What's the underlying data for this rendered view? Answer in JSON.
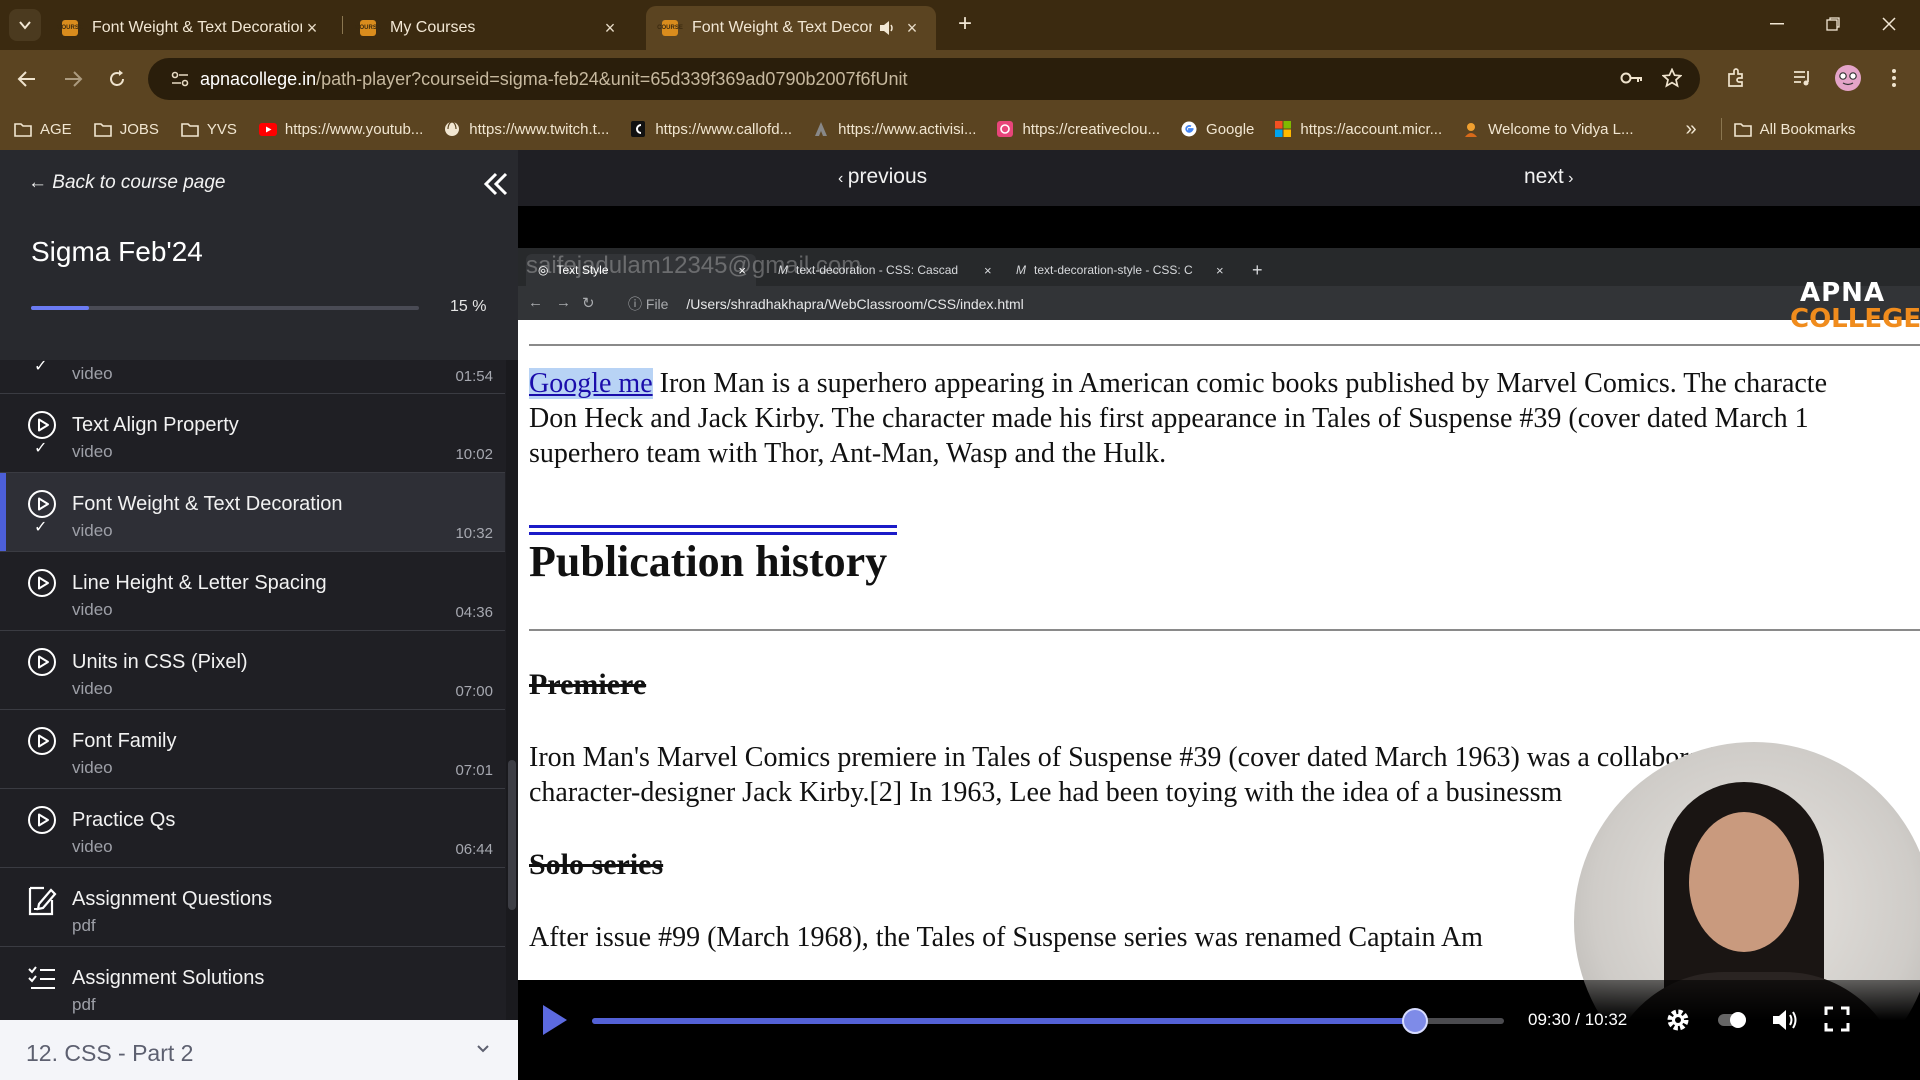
{
  "browser": {
    "tabs": [
      {
        "title": "Font Weight & Text Decoration",
        "favicon": "apna-college-favicon",
        "active": false
      },
      {
        "title": "My Courses",
        "favicon": "apna-college-favicon",
        "active": false
      },
      {
        "title": "Font Weight & Text Decorat",
        "favicon": "apna-college-favicon",
        "active": true
      }
    ],
    "favicon_label": "COURSE",
    "address": {
      "domain": "apnacollege.in",
      "path": "/path-player?courseid=sigma-feb24&unit=65d339f369ad0790b2007f6fUnit"
    },
    "bookmarks": [
      {
        "label": "AGE",
        "icon": "folder-icon"
      },
      {
        "label": "JOBS",
        "icon": "folder-icon"
      },
      {
        "label": "YVS",
        "icon": "folder-icon"
      },
      {
        "label": "https://www.youtub...",
        "icon": "youtube-icon"
      },
      {
        "label": "https://www.twitch.t...",
        "icon": "globe-icon"
      },
      {
        "label": "https://www.callofd...",
        "icon": "cod-icon"
      },
      {
        "label": "https://www.activisi...",
        "icon": "activision-icon"
      },
      {
        "label": "https://creativeclou...",
        "icon": "creative-cloud-icon"
      },
      {
        "label": "Google",
        "icon": "google-icon"
      },
      {
        "label": "https://account.micr...",
        "icon": "microsoft-icon"
      },
      {
        "label": "Welcome to Vidya L...",
        "icon": "vidya-icon"
      }
    ],
    "all_bookmarks_label": "All Bookmarks",
    "accent": "#5b4421"
  },
  "sidebar": {
    "back_label": "Back to course page",
    "course_title": "Sigma Feb'24",
    "progress_percent": 15,
    "progress_label": "15 %",
    "lessons": [
      {
        "name": "",
        "kind": "video",
        "duration": "01:54",
        "icon": "play-circle-icon",
        "done": true,
        "partial": true
      },
      {
        "name": "Text Align Property",
        "kind": "video",
        "duration": "10:02",
        "icon": "play-circle-icon",
        "done": true
      },
      {
        "name": "Font Weight & Text Decoration",
        "kind": "video",
        "duration": "10:32",
        "icon": "play-circle-icon",
        "done": true,
        "active": true
      },
      {
        "name": "Line Height & Letter Spacing",
        "kind": "video",
        "duration": "04:36",
        "icon": "play-circle-icon",
        "done": false
      },
      {
        "name": "Units in CSS (Pixel)",
        "kind": "video",
        "duration": "07:00",
        "icon": "play-circle-icon",
        "done": false
      },
      {
        "name": "Font Family",
        "kind": "video",
        "duration": "07:01",
        "icon": "play-circle-icon",
        "done": false
      },
      {
        "name": "Practice Qs",
        "kind": "video",
        "duration": "06:44",
        "icon": "play-circle-icon",
        "done": false
      },
      {
        "name": "Assignment Questions",
        "kind": "pdf",
        "duration": "",
        "icon": "edit-document-icon",
        "done": false
      },
      {
        "name": "Assignment Solutions",
        "kind": "pdf",
        "duration": "",
        "icon": "checklist-icon",
        "done": false
      }
    ],
    "next_section": "12. CSS - Part 2"
  },
  "player": {
    "prev_label": "previous",
    "next_label": "next",
    "time_label": "09:30 / 10:32",
    "progress": 0.902,
    "seek_accent": "#5361d6"
  },
  "recording": {
    "watermark": "saifejadulam12345@gmail.com",
    "tabs": [
      {
        "title": "Text Style",
        "active": true
      },
      {
        "title": "text-decoration - CSS: Cascad",
        "active": false
      },
      {
        "title": "text-decoration-style - CSS: C",
        "active": false
      }
    ],
    "file_label": "File",
    "url": "/Users/shradhakhapra/WebClassroom/CSS/index.html",
    "brand_top": "APNA",
    "brand_bottom": "COLLEGE",
    "page": {
      "link_text": "Google me",
      "para1_rest": " Iron Man is a superhero appearing in American comic books published by Marvel Comics. The characte",
      "para1_line2": "Don Heck and Jack Kirby. The character made his first appearance in Tales of Suspense #39 (cover dated March 1",
      "para1_line3": "superhero team with Thor, Ant-Man, Wasp and the Hulk.",
      "heading1": "Publication history",
      "heading2": "Premiere",
      "para2_line1": "Iron Man's Marvel Comics premiere in Tales of Suspense #39 (cover dated March 1963) was a collaboration an",
      "para2_line2": "character-designer Jack Kirby.[2] In 1963, Lee had been toying with the idea of a businessm",
      "heading3": "Solo series",
      "para3_line1": "After issue #99 (March 1968), the Tales of Suspense series was renamed Captain Am"
    }
  }
}
